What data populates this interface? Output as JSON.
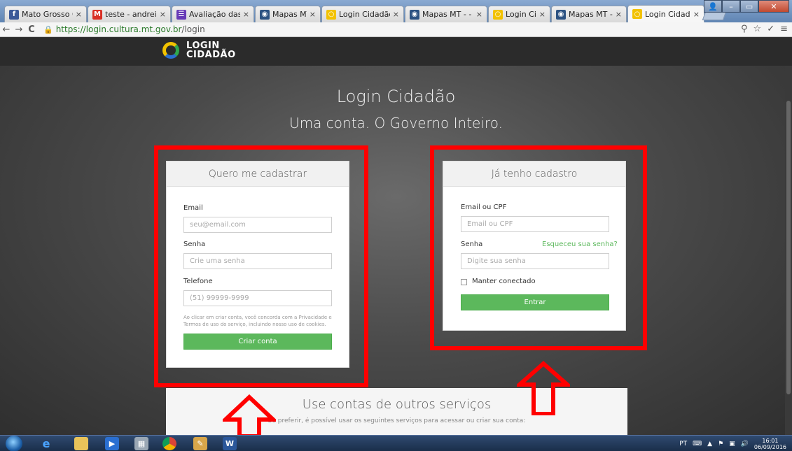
{
  "browser": {
    "tabs": [
      {
        "label": "Mato Grosso Criat",
        "icon": "facebook-icon",
        "color": "#3b5998",
        "glyph": "f"
      },
      {
        "label": "teste - andreiarovi",
        "icon": "gmail-icon",
        "color": "#d93025",
        "glyph": "M"
      },
      {
        "label": "Avaliação das Con",
        "icon": "forms-icon",
        "color": "#673ab7",
        "glyph": "☰"
      },
      {
        "label": "Mapas MT",
        "icon": "mapas-icon",
        "color": "#2c5282",
        "glyph": "◉"
      },
      {
        "label": "Login Cidadão",
        "icon": "login-cidadao-icon",
        "color": "#f2c200",
        "glyph": "○"
      },
      {
        "label": "Mapas MT - - Map",
        "icon": "mapas-icon",
        "color": "#2c5282",
        "glyph": "◉"
      },
      {
        "label": "Login Cidadão",
        "icon": "login-cidadao-icon",
        "color": "#f2c200",
        "glyph": "○"
      },
      {
        "label": "Mapas MT - Pales",
        "icon": "mapas-icon",
        "color": "#2c5282",
        "glyph": "◉"
      },
      {
        "label": "Login Cidadão",
        "icon": "login-cidadao-icon",
        "color": "#f2c200",
        "glyph": "○",
        "active": true
      }
    ],
    "url_host": "https://login.cultura.mt.gov.br",
    "url_path": "/login"
  },
  "site": {
    "logo_line1": "LOGIN",
    "logo_line2": "CIDADÃO",
    "title": "Login Cidadão",
    "tagline": "Uma conta. O Governo Inteiro."
  },
  "register": {
    "header": "Quero me cadastrar",
    "email_label": "Email",
    "email_placeholder": "seu@email.com",
    "password_label": "Senha",
    "password_placeholder": "Crie uma senha",
    "phone_label": "Telefone",
    "phone_placeholder": "(51) 99999-9999",
    "terms_line1": "Ao clicar em criar conta, você concorda com a Privacidade e",
    "terms_line2": "Termos de uso do serviço, incluindo nosso uso de cookies.",
    "submit_label": "Criar conta"
  },
  "login": {
    "header": "Já tenho cadastro",
    "email_label": "Email ou CPF",
    "email_placeholder": "Email ou CPF",
    "password_label": "Senha",
    "forgot_label": "Esqueceu sua senha?",
    "password_placeholder": "Digite sua senha",
    "remember_label": "Manter conectado",
    "submit_label": "Entrar"
  },
  "other_services": {
    "title": "Use contas de outros serviços",
    "subtitle": "Se preferir, é possível usar os seguintes serviços para acessar ou criar sua conta:"
  },
  "taskbar": {
    "language": "PT",
    "time": "16:01",
    "date": "06/09/2016"
  },
  "colors": {
    "accent_green": "#5cb85c",
    "highlight_red": "#ff0000"
  }
}
